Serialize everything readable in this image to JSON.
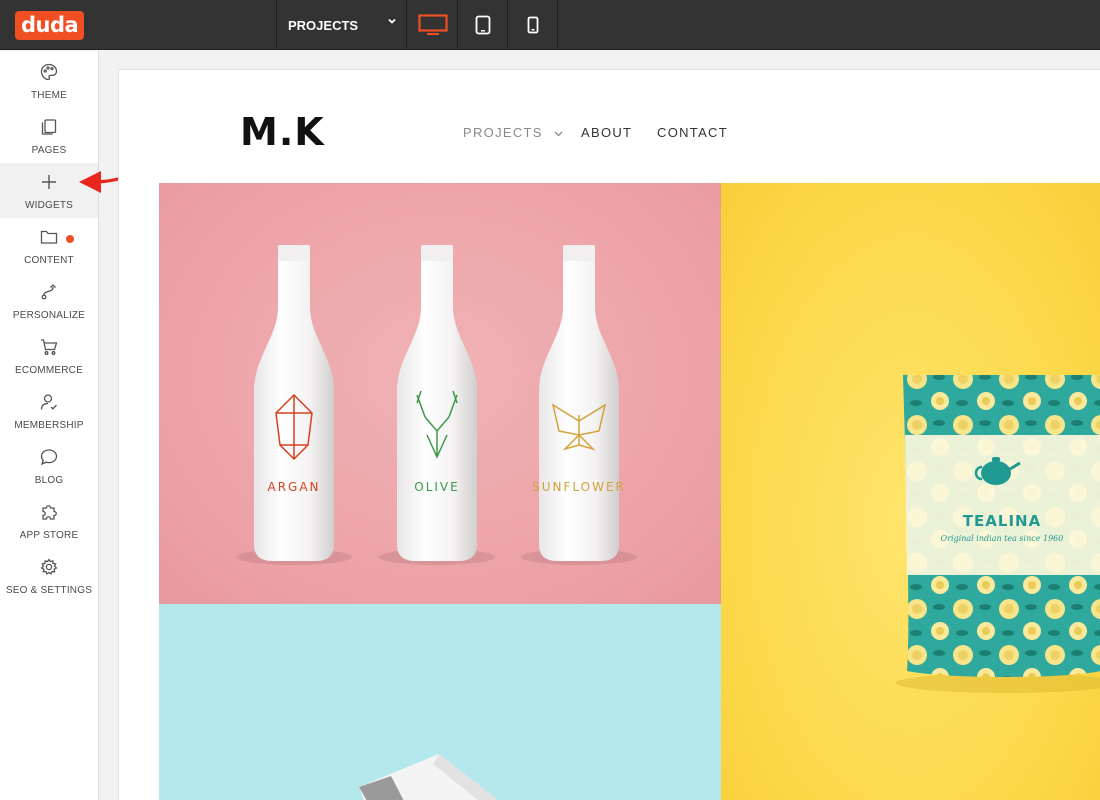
{
  "app": {
    "logo_text": "duda",
    "page_selector": {
      "selected": "PROJECTS"
    },
    "devices": [
      "desktop-icon",
      "tablet-icon",
      "mobile-icon"
    ],
    "active_device": "desktop",
    "accent_color": "#f04e23"
  },
  "sidebar": {
    "items": [
      {
        "label": "THEME",
        "icon": "palette-icon"
      },
      {
        "label": "PAGES",
        "icon": "pages-icon"
      },
      {
        "label": "WIDGETS",
        "icon": "plus-icon",
        "active": true
      },
      {
        "label": "CONTENT",
        "icon": "folder-icon",
        "has_notification": true
      },
      {
        "label": "PERSONALIZE",
        "icon": "personalize-icon"
      },
      {
        "label": "ECOMMERCE",
        "icon": "cart-icon"
      },
      {
        "label": "MEMBERSHIP",
        "icon": "member-icon"
      },
      {
        "label": "BLOG",
        "icon": "chat-bubble-icon"
      },
      {
        "label": "APP STORE",
        "icon": "puzzle-icon"
      },
      {
        "label": "SEO & SETTINGS",
        "icon": "gear-icon"
      }
    ]
  },
  "site": {
    "logo": "M.K",
    "nav": [
      {
        "label": "PROJECTS",
        "has_dropdown": true
      },
      {
        "label": "ABOUT"
      },
      {
        "label": "CONTACT"
      }
    ],
    "tiles": {
      "bottles": [
        "ARGAN",
        "OLIVE",
        "SUNFLOWER"
      ],
      "pouch_brand": "TEALINA",
      "pouch_tagline": "Original indian tea since 1960"
    }
  }
}
